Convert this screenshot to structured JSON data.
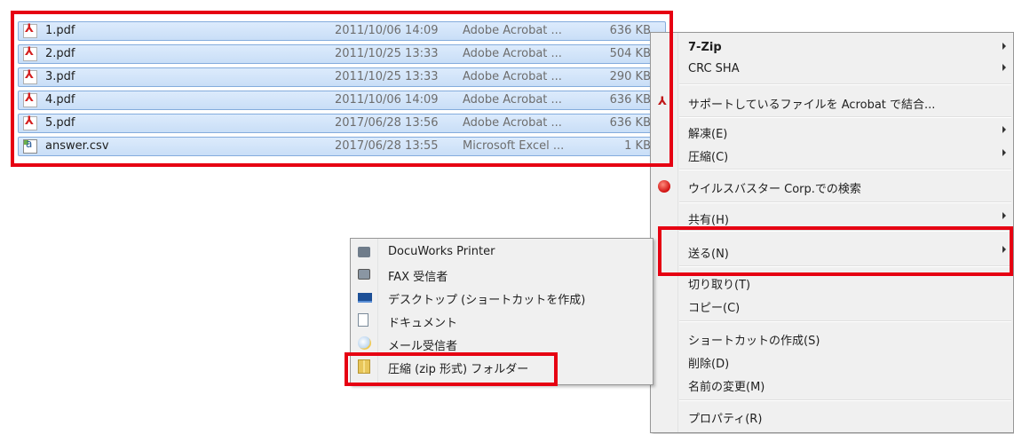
{
  "files": [
    {
      "name": "1.pdf",
      "date": "2011/10/06 14:09",
      "type": "Adobe Acrobat ...",
      "size": "636 KB",
      "icon": "pdf-icon"
    },
    {
      "name": "2.pdf",
      "date": "2011/10/25 13:33",
      "type": "Adobe Acrobat ...",
      "size": "504 KB",
      "icon": "pdf-icon"
    },
    {
      "name": "3.pdf",
      "date": "2011/10/25 13:33",
      "type": "Adobe Acrobat ...",
      "size": "290 KB",
      "icon": "pdf-icon"
    },
    {
      "name": "4.pdf",
      "date": "2011/10/06 14:09",
      "type": "Adobe Acrobat ...",
      "size": "636 KB",
      "icon": "pdf-icon"
    },
    {
      "name": "5.pdf",
      "date": "2017/06/28 13:56",
      "type": "Adobe Acrobat ...",
      "size": "636 KB",
      "icon": "pdf-icon"
    },
    {
      "name": "answer.csv",
      "date": "2017/06/28 13:55",
      "type": "Microsoft Excel ...",
      "size": "1 KB",
      "icon": "csv-icon"
    }
  ],
  "context_menu": {
    "items": [
      {
        "label": "7-Zip",
        "submenu": true,
        "bold": true
      },
      {
        "label": "CRC SHA",
        "submenu": true
      },
      {
        "label": "サポートしているファイルを Acrobat で結合...",
        "icon": "acrobat-icon"
      },
      {
        "label": "解凍(E)",
        "submenu": true
      },
      {
        "label": "圧縮(C)",
        "submenu": true
      },
      {
        "label": "ウイルスバスター Corp.での検索",
        "icon": "virusbuster-icon"
      },
      {
        "label": "共有(H)",
        "submenu": true
      },
      {
        "label": "送る(N)",
        "submenu": true,
        "highlighted": true
      },
      {
        "label": "切り取り(T)"
      },
      {
        "label": "コピー(C)"
      },
      {
        "label": "ショートカットの作成(S)"
      },
      {
        "label": "削除(D)"
      },
      {
        "label": "名前の変更(M)"
      },
      {
        "label": "プロパティ(R)"
      }
    ]
  },
  "send_to_menu": {
    "items": [
      {
        "label": "DocuWorks Printer",
        "icon": "printer-icon"
      },
      {
        "label": "FAX 受信者",
        "icon": "fax-icon"
      },
      {
        "label": "デスクトップ (ショートカットを作成)",
        "icon": "desktop-icon"
      },
      {
        "label": "ドキュメント",
        "icon": "document-icon"
      },
      {
        "label": "メール受信者",
        "icon": "mail-icon"
      },
      {
        "label": "圧縮 (zip 形式) フォルダー",
        "icon": "zip-folder-icon",
        "highlighted": true
      }
    ]
  },
  "highlight_color": "#e60012",
  "selection_color": "#cce0f7"
}
